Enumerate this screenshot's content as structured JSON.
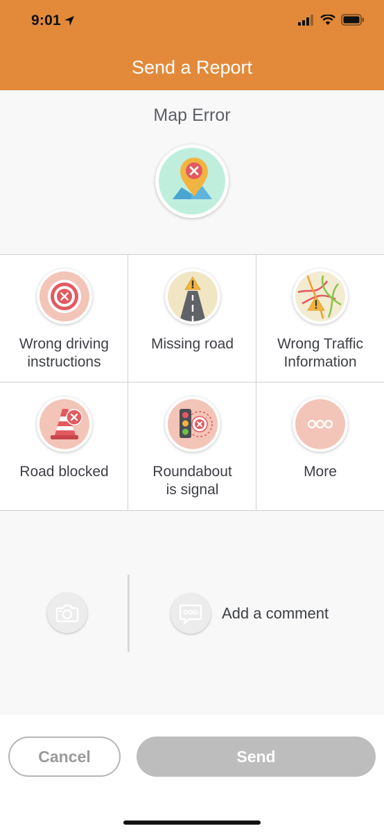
{
  "status_bar": {
    "time": "9:01"
  },
  "header": {
    "title": "Send a Report"
  },
  "section": {
    "title": "Map Error"
  },
  "options": [
    {
      "label_line1": "Wrong driving",
      "label_line2": "instructions",
      "icon": "wrong-directions-icon",
      "color": "#f3c4b8"
    },
    {
      "label_line1": "Missing road",
      "label_line2": "",
      "icon": "missing-road-icon",
      "color": "#f1e6c4"
    },
    {
      "label_line1": "Wrong Traffic",
      "label_line2": "Information",
      "icon": "traffic-map-icon",
      "color": "#f3ecd2"
    },
    {
      "label_line1": "Road blocked",
      "label_line2": "",
      "icon": "traffic-cone-icon",
      "color": "#f3c4b8"
    },
    {
      "label_line1": "Roundabout",
      "label_line2": "is signal",
      "icon": "traffic-light-icon",
      "color": "#f3c4b8"
    },
    {
      "label_line1": "More",
      "label_line2": "",
      "icon": "more-dots-icon",
      "color": "#f3c4b8"
    }
  ],
  "comment": {
    "label": "Add a comment"
  },
  "actions": {
    "cancel": "Cancel",
    "send": "Send"
  },
  "colors": {
    "brand": "#e28a3a",
    "error_red": "#e25a60",
    "disabled": "#bdbdbd"
  }
}
